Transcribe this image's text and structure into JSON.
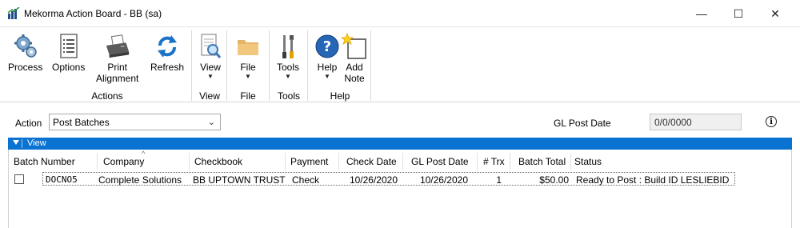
{
  "window": {
    "title": "Mekorma Action Board  -  BB (sa)",
    "controls": {
      "minimize": "—",
      "maximize": "☐",
      "close": "✕"
    }
  },
  "ribbon": {
    "buttons": [
      {
        "id": "process",
        "label": "Process",
        "icon": "gears-icon"
      },
      {
        "id": "options",
        "label": "Options",
        "icon": "list-icon"
      },
      {
        "id": "print_alignment",
        "label": "Print Alignment",
        "line1": "Print",
        "line2": "Alignment",
        "icon": "printer-icon"
      },
      {
        "id": "refresh",
        "label": "Refresh",
        "icon": "refresh-icon"
      },
      {
        "id": "view",
        "label": "View",
        "icon": "document-magnifier-icon",
        "dropdown": true
      },
      {
        "id": "file",
        "label": "File",
        "icon": "folder-icon",
        "dropdown": true
      },
      {
        "id": "tools",
        "label": "Tools",
        "icon": "tools-icon",
        "dropdown": true
      },
      {
        "id": "help",
        "label": "Help",
        "icon": "help-icon",
        "dropdown": true
      },
      {
        "id": "add_note",
        "label": "Add Note",
        "line1": "Add",
        "line2": "Note",
        "icon": "note-icon"
      }
    ],
    "groups": [
      "Actions",
      "View",
      "File",
      "Tools",
      "Help"
    ],
    "caret": "▼"
  },
  "action_bar": {
    "action_label": "Action",
    "action_value": "Post Batches",
    "gl_post_date_label": "GL Post Date",
    "gl_post_date_value": "0/0/0000",
    "info": "i"
  },
  "view_bar": {
    "label": "View"
  },
  "grid": {
    "columns": [
      "Batch Number",
      "Company",
      "Checkbook",
      "Payment",
      "Check Date",
      "GL Post Date",
      "# Trx",
      "Batch Total",
      "Status"
    ],
    "rows": [
      {
        "batch_number": "DOCNO5",
        "company": "Complete Solutions",
        "checkbook": "BB UPTOWN TRUST",
        "payment": "Check",
        "check_date": "10/26/2020",
        "gl_post_date": "10/26/2020",
        "trx": "1",
        "batch_total": "$50.00",
        "status": "Ready to Post : Build ID LESLIEBID",
        "selected": false
      }
    ]
  },
  "colors": {
    "accent": "#0a73d2"
  }
}
